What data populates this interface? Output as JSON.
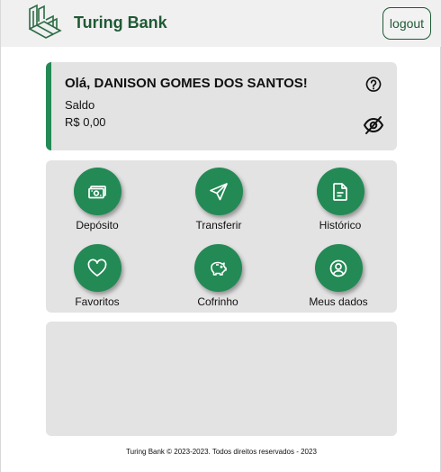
{
  "header": {
    "brand": "Turing Bank",
    "logout_label": "logout"
  },
  "balance_card": {
    "greeting": "Olá, DANISON GOMES DOS SANTOS!",
    "saldo_label": "Saldo",
    "saldo_value": "R$ 0,00"
  },
  "actions": [
    {
      "label": "Depósito",
      "icon": "money-icon"
    },
    {
      "label": "Transferir",
      "icon": "send-icon"
    },
    {
      "label": "Histórico",
      "icon": "document-icon"
    },
    {
      "label": "Favoritos",
      "icon": "heart-icon"
    },
    {
      "label": "Cofrinho",
      "icon": "piggy-bank-icon"
    },
    {
      "label": "Meus dados",
      "icon": "user-circle-icon"
    }
  ],
  "footer": {
    "text": "Turing Bank © 2023-2023. Todos direitos reservados - 2023"
  },
  "colors": {
    "brand_green": "#1e5a34",
    "action_green": "#238a55",
    "card_gray": "#e3e3e3",
    "header_gray": "#f0f0f0"
  }
}
